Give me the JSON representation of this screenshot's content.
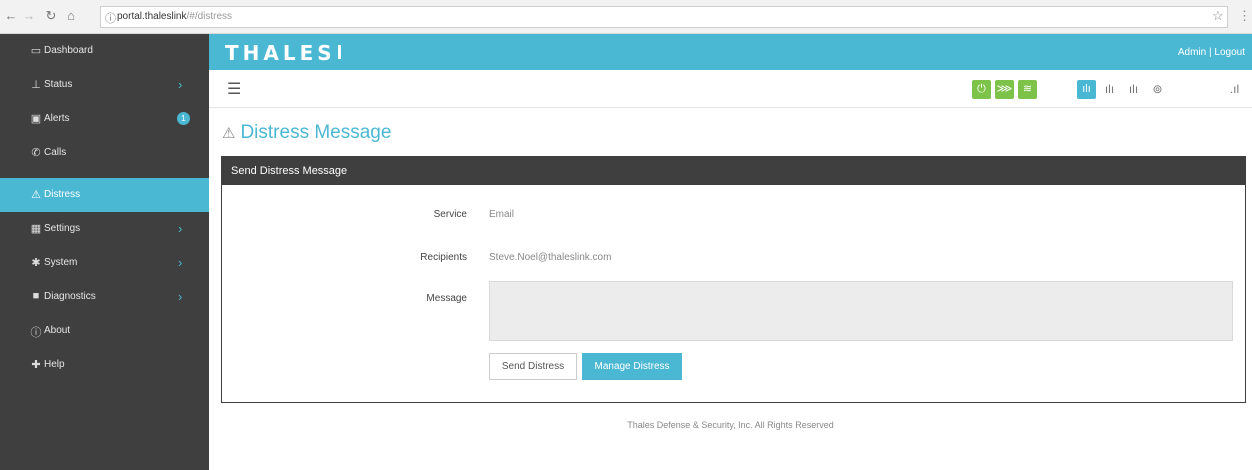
{
  "browser": {
    "url_host": "portal.thaleslink",
    "url_path": "/#/distress"
  },
  "header": {
    "logo": "THALES",
    "admin_label": "Admin",
    "separator": "|",
    "logout_label": "Logout",
    "accent_color": "#4bb8d3"
  },
  "sidebar": {
    "items": [
      {
        "label": "Dashboard",
        "icon": "monitor-icon"
      },
      {
        "label": "Status",
        "icon": "chart-icon"
      },
      {
        "label": "Alerts",
        "icon": "alert-box-icon",
        "badge": "1"
      },
      {
        "label": "Calls",
        "icon": "phone-icon"
      },
      {
        "label": "Distress",
        "icon": "warning-icon"
      },
      {
        "label": "Settings",
        "icon": "grid-icon"
      },
      {
        "label": "System",
        "icon": "gear-icon"
      },
      {
        "label": "Diagnostics",
        "icon": "camera-icon"
      },
      {
        "label": "About",
        "icon": "info-icon"
      },
      {
        "label": "Help",
        "icon": "lifebuoy-icon"
      }
    ]
  },
  "page": {
    "title": "Distress Message"
  },
  "panel": {
    "heading": "Send Distress Message",
    "service_label": "Service",
    "service_value": "Email",
    "recipients_label": "Recipients",
    "recipients_value": "Steve.Noel@thaleslink.com",
    "message_label": "Message",
    "message_value": "",
    "send_button": "Send Distress",
    "manage_button": "Manage Distress"
  },
  "footer": {
    "text": "Thales Defense & Security, Inc. All Rights Reserved"
  }
}
